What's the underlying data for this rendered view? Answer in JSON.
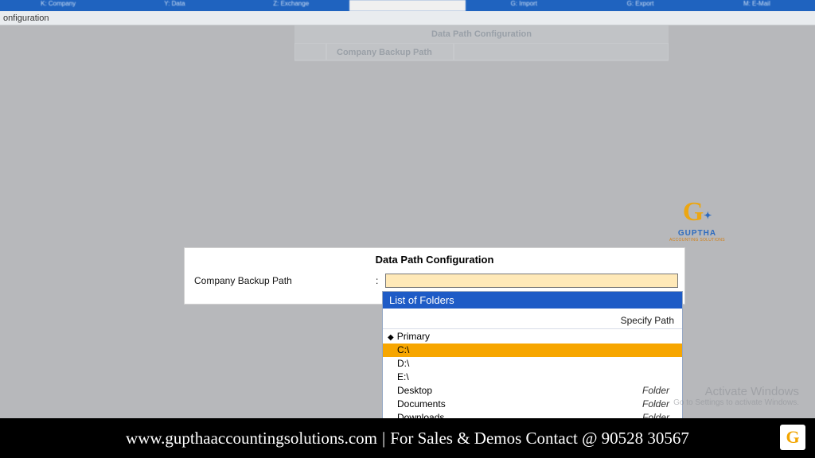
{
  "toolbar": {
    "items": [
      "K: Company",
      "Y: Data",
      "Z: Exchange",
      "",
      "G: Import",
      "G: Export",
      "M: E-Mail"
    ],
    "active_index": 3
  },
  "breadcrumb": "onfiguration",
  "ghost": {
    "title": "Data Path Configuration",
    "label": "Company Backup Path"
  },
  "dialog": {
    "title": "Data Path Configuration",
    "label": "Company Backup Path",
    "colon": ":",
    "value": ""
  },
  "folderlist": {
    "header": "List of Folders",
    "specify": "Specify Path",
    "primary": "Primary",
    "items": [
      {
        "name": "C:\\",
        "type": "",
        "selected": true
      },
      {
        "name": "D:\\",
        "type": "",
        "selected": false
      },
      {
        "name": "E:\\",
        "type": "",
        "selected": false
      },
      {
        "name": "Desktop",
        "type": "Folder",
        "selected": false
      },
      {
        "name": "Documents",
        "type": "Folder",
        "selected": false
      },
      {
        "name": "Downloads",
        "type": "Folder",
        "selected": false
      }
    ]
  },
  "activate": {
    "line1": "Activate Windows",
    "line2": "Go to Settings to activate Windows."
  },
  "logo": {
    "name": "GUPTHA",
    "sub": "ACCOUNTING SOLUTIONS"
  },
  "footer": {
    "url": "www.gupthaaccountingsolutions.com",
    "sep": "|",
    "text": "For Sales & Demos Contact @ 90528 30567"
  }
}
